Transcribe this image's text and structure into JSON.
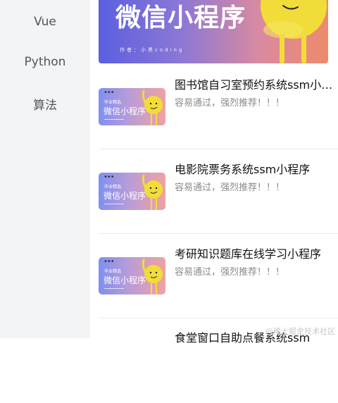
{
  "sidebar": {
    "items": [
      {
        "label": "Vue"
      },
      {
        "label": "Python"
      },
      {
        "label": "算法"
      }
    ]
  },
  "banner": {
    "title": "微信小程序",
    "author": "作者：小黑coding"
  },
  "list": {
    "items": [
      {
        "title": "图书馆自习室预约系统ssm小程序",
        "subtitle": "容易通过，强烈推荐！！！",
        "thumb_small": "毕业精选",
        "thumb_title": "微信小程序"
      },
      {
        "title": "电影院票务系统ssm小程序",
        "subtitle": "容易通过，强烈推荐！！！",
        "thumb_small": "毕业精选",
        "thumb_title": "微信小程序"
      },
      {
        "title": "考研知识题库在线学习小程序",
        "subtitle": "容易通过，强烈推荐！！！",
        "thumb_small": "毕业精选",
        "thumb_title": "微信小程序"
      },
      {
        "title": "食堂窗口自助点餐系统ssm",
        "subtitle": "",
        "thumb_small": "",
        "thumb_title": ""
      }
    ]
  },
  "watermark": "@稀土掘金技术社区",
  "colors": {
    "sidebar_bg": "#f3f4f6",
    "banner_gradient": [
      "#5b5fe0",
      "#ee8a6b"
    ],
    "mascot": "#f2dc3a"
  }
}
